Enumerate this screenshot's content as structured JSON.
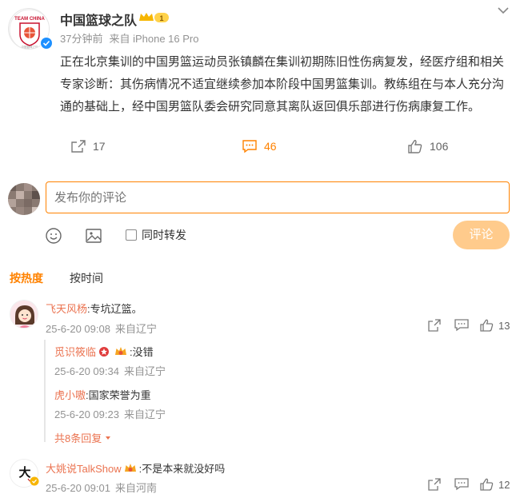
{
  "post": {
    "author": "中国篮球之队",
    "time": "37分钟前",
    "source": "来自 iPhone 16 Pro",
    "text": "正在北京集训的中国男篮运动员张镇麟在集训初期陈旧性伤病复发，经医疗组和相关专家诊断：其伤病情况不适宜继续参加本阶段中国男篮集训。教练组在与本人充分沟通的基础上，经中国男篮队委会研究同意其离队返回俱乐部进行伤病康复工作。",
    "crown_level": "1",
    "avatar_text_top": "TEAM CHINA",
    "avatar_text_bottom": "中国篮球之队",
    "repost_count": "17",
    "comment_count": "46",
    "like_count": "106"
  },
  "composer": {
    "placeholder": "发布你的评论",
    "repost_label": "同时转发",
    "submit_label": "评论"
  },
  "sort": {
    "hot": "按热度",
    "time": "按时间"
  },
  "comments": [
    {
      "user": "飞天风杨",
      "text": ":专坑辽篮。",
      "time": "25-6-20 09:08",
      "source": "来自辽宁",
      "likes": "13",
      "replies": [
        {
          "user": "觅识筱临",
          "text": ":没错",
          "time": "25-6-20 09:34",
          "source": "来自辽宁"
        },
        {
          "user": "虎小嗷",
          "text": ":国家荣誉为重",
          "time": "25-6-20 09:23",
          "source": "来自辽宁"
        }
      ],
      "more_replies": "共8条回复"
    },
    {
      "user": "大姚说TalkShow",
      "text": ":不是本来就没好吗",
      "time": "25-6-20 09:01",
      "source": "来自河南",
      "likes": "12",
      "avatar_text": "大"
    }
  ],
  "colors": {
    "accent": "#ff8200",
    "username": "#eb7350",
    "muted": "#939393",
    "verified": "#1e90ff"
  },
  "icons": [
    "chevron-down-icon",
    "repost-icon",
    "comment-icon",
    "like-icon",
    "emoji-icon",
    "image-icon",
    "share-icon",
    "reply-icon",
    "crown-icon",
    "verified-icon"
  ]
}
